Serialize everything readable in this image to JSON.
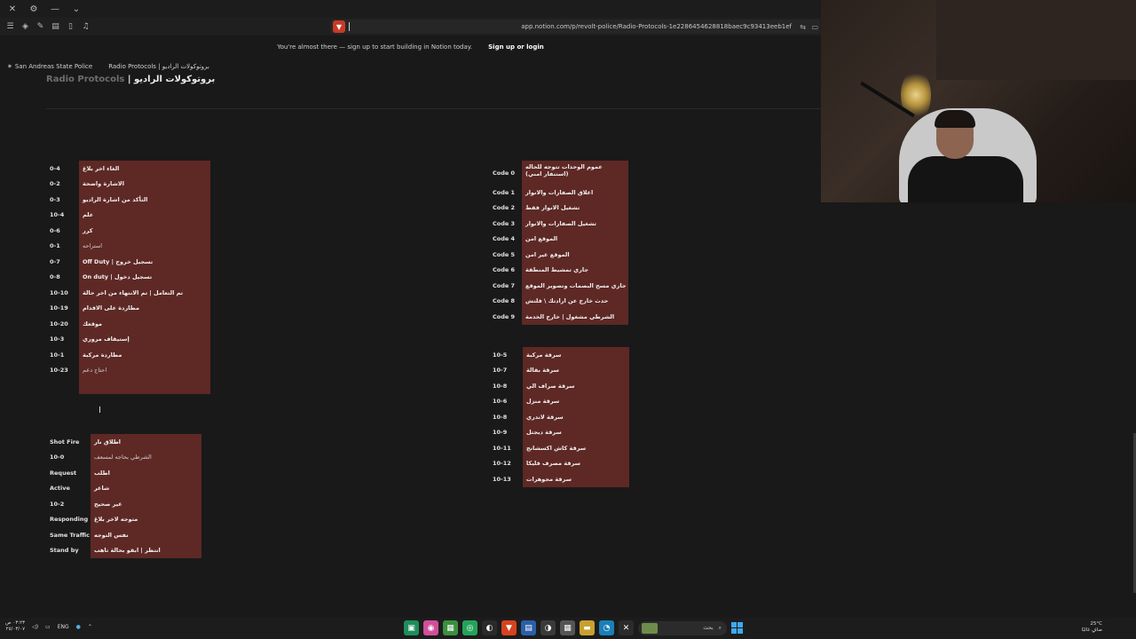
{
  "titlebar": {
    "close": "✕",
    "gear": "⚙",
    "minimize": "—",
    "chevron": "⌄"
  },
  "browser": {
    "url": "app.notion.com/p/revolt-police/Radio-Protocols-1e2286454628818baec9c93413eeb1ef"
  },
  "banner": {
    "text": "You're almost there — sign up to start building in Notion today.",
    "button": "Sign up or login"
  },
  "breadcrumbs": [
    "San Andreas State Police",
    "Radio Protocols | بروتوكولات الراديو"
  ],
  "page_title": {
    "en": "Radio Protocols",
    "sep": " | ",
    "ar": "بروتوكولات الراديو"
  },
  "tables": {
    "left_top": [
      [
        "0-4",
        "الغاء اخر بلاغ"
      ],
      [
        "0-2",
        "الاشارة واضحة"
      ],
      [
        "0-3",
        "التأكد من اشارة الراديو"
      ],
      [
        "10-4",
        "علم"
      ],
      [
        "0-6",
        "كرر"
      ],
      [
        "0-1",
        "استراحه"
      ],
      [
        "0-7",
        "Off Duty | تسجيل خروج"
      ],
      [
        "0-8",
        "On duty | تسجيل دخول"
      ],
      [
        "10-10",
        "تم التعامل | تم الانتهاء من اخر حالة"
      ],
      [
        "10-19",
        "مطاردة على الاقدام"
      ],
      [
        "10-20",
        "موقعك"
      ],
      [
        "10-3",
        "إستيقاف مروري"
      ],
      [
        "10-1",
        "مطاردة مركبة"
      ],
      [
        "10-23",
        "احتاج دعم"
      ],
      [
        "",
        ""
      ]
    ],
    "left_bottom": [
      [
        "Shot Fire",
        "اطلاق نار"
      ],
      [
        "10-0",
        "الشرطي بحاجه لمسعف"
      ],
      [
        "Request",
        "اطلب"
      ],
      [
        "Active",
        "شاغر"
      ],
      [
        "10-2",
        "غير صحيح"
      ],
      [
        "Responding",
        "متوجه لاخر بلاغ"
      ],
      [
        "Same Traffic",
        "نفس التوجه"
      ],
      [
        "Stand by",
        "انتظر | ابقو بحالة تاهب"
      ]
    ],
    "right_top": [
      [
        "Code 0",
        "عموم الوحدات تتوجه للحاله (استنفار امني)"
      ],
      [
        "Code 1",
        "اغلاق الصفارات والانوار"
      ],
      [
        "Code 2",
        "تشغيل الانوار فقط"
      ],
      [
        "Code 3",
        "تشغيل الصفارات والانوار"
      ],
      [
        "Code 4",
        "الموقع امن"
      ],
      [
        "Code 5",
        "الموقع غير امن"
      ],
      [
        "Code 6",
        "جاري تمشيط المنطقة"
      ],
      [
        "Code 7",
        "جاري مسح البصمات وتصوير الموقع"
      ],
      [
        "Code 8",
        "حدث خارج عن ارادتك \\ فلتش"
      ],
      [
        "Code 9",
        "الشرطي مشغول | خارج الخدمة"
      ]
    ],
    "right_bottom": [
      [
        "10-5",
        "سرقة مركبة"
      ],
      [
        "10-7",
        "سرقة بقالة"
      ],
      [
        "10-8",
        "سرقة صراف الي"
      ],
      [
        "10-6",
        "سرقة منزل"
      ],
      [
        "10-8",
        "سرقة لاندري"
      ],
      [
        "10-9",
        "سرقة ديجتل"
      ],
      [
        "10-11",
        "سرقة كاش اكسشانج"
      ],
      [
        "10-12",
        "سرقة مصرف فليكا"
      ],
      [
        "10-13",
        "سرقة مجوهرات"
      ]
    ]
  },
  "taskbar": {
    "time": "٠٣:٢٣ ص",
    "date": "٢٥/٠٣/٠٧",
    "lang": "ENG",
    "search_placeholder": "بحث",
    "weather_temp": "25°C",
    "weather_text": "صافٍ غالبًا"
  },
  "colors": {
    "cell_red": "#5e2825",
    "bg": "#191919"
  }
}
